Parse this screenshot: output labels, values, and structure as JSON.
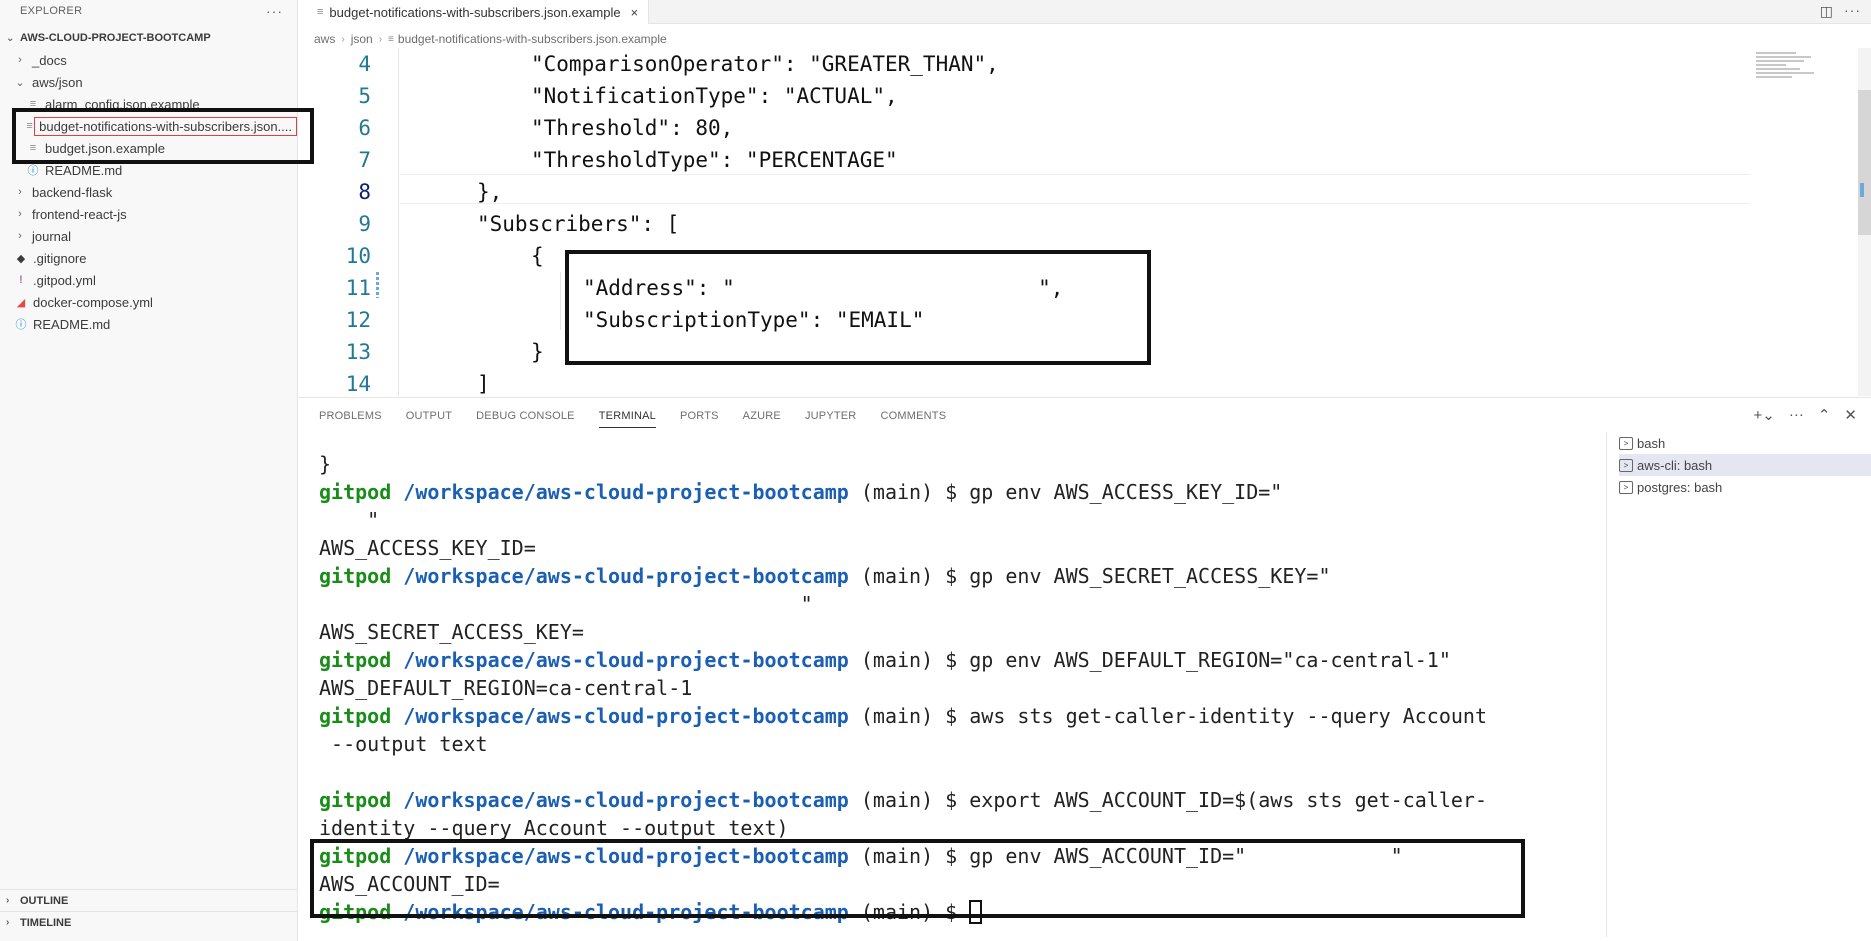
{
  "explorer": {
    "title": "EXPLORER",
    "more": "···",
    "root": "AWS-CLOUD-PROJECT-BOOTCAMP",
    "items": [
      {
        "label": "_docs",
        "type": "folder",
        "state": "collapsed"
      },
      {
        "label": "aws/json",
        "type": "folder",
        "state": "expanded"
      },
      {
        "label": "alarm_config.json.example",
        "type": "file"
      },
      {
        "label": "budget-notifications-with-subscribers.json....",
        "type": "file",
        "selected": true
      },
      {
        "label": "budget.json.example",
        "type": "file"
      },
      {
        "label": "README.md",
        "type": "file"
      },
      {
        "label": "backend-flask",
        "type": "folder",
        "state": "collapsed"
      },
      {
        "label": "frontend-react-js",
        "type": "folder",
        "state": "collapsed"
      },
      {
        "label": "journal",
        "type": "folder",
        "state": "collapsed"
      },
      {
        "label": ".gitignore",
        "type": "file"
      },
      {
        "label": ".gitpod.yml",
        "type": "file"
      },
      {
        "label": "docker-compose.yml",
        "type": "file"
      },
      {
        "label": "README.md",
        "type": "file"
      }
    ],
    "outline": "OUTLINE",
    "timeline": "TIMELINE"
  },
  "editor": {
    "tab_label": "budget-notifications-with-subscribers.json.example",
    "tab_close": "×",
    "breadcrumb": [
      "aws",
      "json",
      "budget-notifications-with-subscribers.json.example"
    ],
    "lines": [
      {
        "n": "4",
        "text": "\"ComparisonOperator\": \"GREATER_THAN\","
      },
      {
        "n": "5",
        "text": "\"NotificationType\": \"ACTUAL\","
      },
      {
        "n": "6",
        "text": "\"Threshold\": 80,"
      },
      {
        "n": "7",
        "text": "\"ThresholdType\": \"PERCENTAGE\""
      },
      {
        "n": "8",
        "text": "},"
      },
      {
        "n": "9",
        "text": "\"Subscribers\": ["
      },
      {
        "n": "10",
        "text": "{"
      },
      {
        "n": "11",
        "text": "\"Address\": \"                        \","
      },
      {
        "n": "12",
        "text": "\"SubscriptionType\": \"EMAIL\""
      },
      {
        "n": "13",
        "text": "}"
      },
      {
        "n": "14",
        "text": "]"
      }
    ]
  },
  "panel": {
    "tabs": [
      "PROBLEMS",
      "OUTPUT",
      "DEBUG CONSOLE",
      "TERMINAL",
      "PORTS",
      "AZURE",
      "JUPYTER",
      "COMMENTS"
    ],
    "active_tab": "TERMINAL",
    "prompt_user": "gitpod",
    "prompt_path": "/workspace/aws-cloud-project-bootcamp",
    "prompt_branch": " (main) $ ",
    "terminal_lines": [
      {
        "type": "out",
        "text": "}"
      },
      {
        "type": "cmd",
        "text": "gp env AWS_ACCESS_KEY_ID=\""
      },
      {
        "type": "out",
        "text": "    \""
      },
      {
        "type": "out",
        "text": "AWS_ACCESS_KEY_ID="
      },
      {
        "type": "cmd",
        "text": "gp env AWS_SECRET_ACCESS_KEY=\""
      },
      {
        "type": "out",
        "text": "                                        \""
      },
      {
        "type": "out",
        "text": "AWS_SECRET_ACCESS_KEY="
      },
      {
        "type": "cmd",
        "text": "gp env AWS_DEFAULT_REGION=\"ca-central-1\""
      },
      {
        "type": "out",
        "text": "AWS_DEFAULT_REGION=ca-central-1"
      },
      {
        "type": "cmd",
        "text": "aws sts get-caller-identity --query Account"
      },
      {
        "type": "out",
        "text": " --output text"
      },
      {
        "type": "out",
        "text": ""
      },
      {
        "type": "cmd",
        "text": "export AWS_ACCOUNT_ID=$(aws sts get-caller-"
      },
      {
        "type": "out",
        "text": "identity --query Account --output text)"
      },
      {
        "type": "cmd",
        "text": "gp env AWS_ACCOUNT_ID=\"            \""
      },
      {
        "type": "out",
        "text": "AWS_ACCOUNT_ID="
      },
      {
        "type": "cmd",
        "text": ""
      }
    ],
    "terminals": [
      {
        "label": "bash"
      },
      {
        "label": "aws-cli: bash",
        "active": true
      },
      {
        "label": "postgres: bash"
      }
    ]
  }
}
